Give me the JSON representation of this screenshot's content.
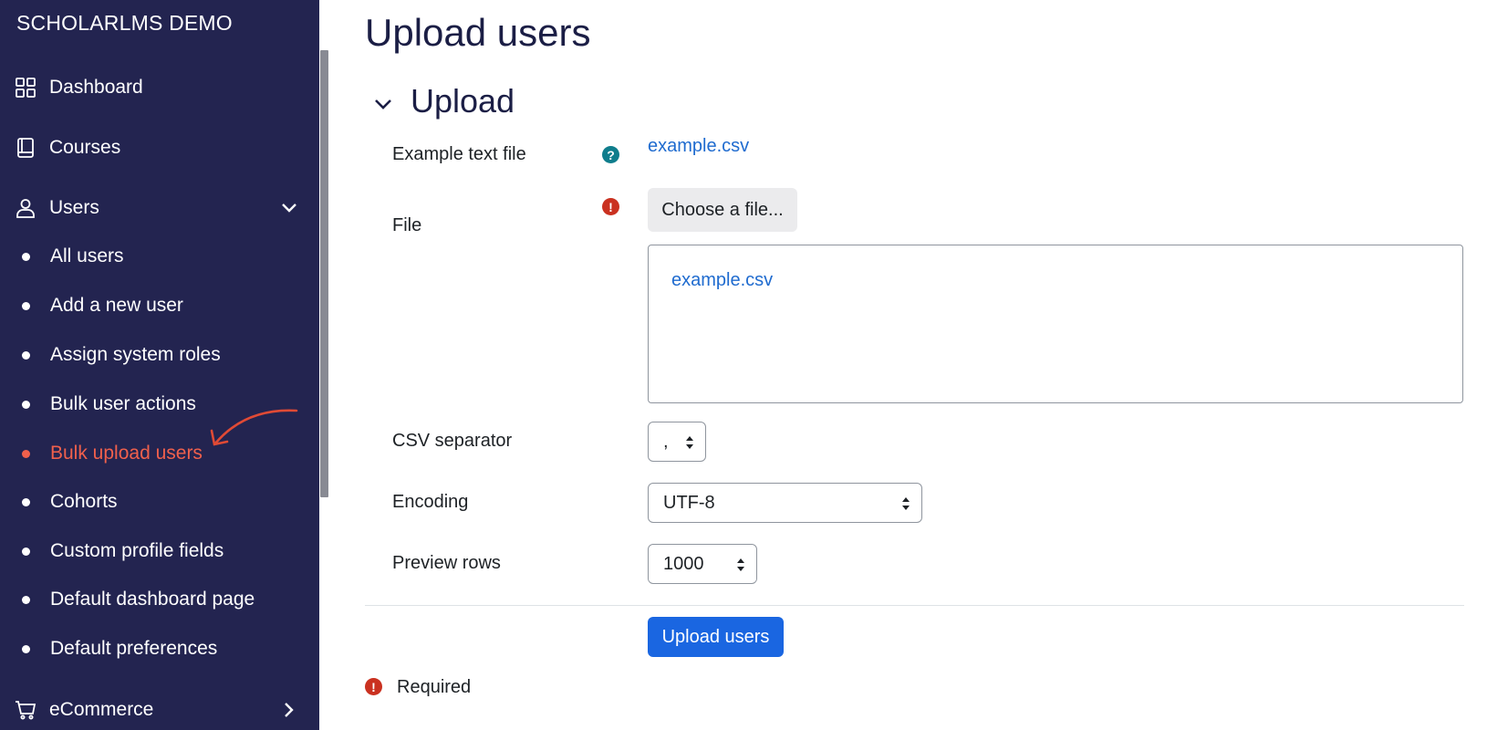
{
  "sidebar": {
    "brand": "SCHOLARLMS DEMO",
    "items": [
      {
        "label": "Dashboard",
        "icon": "grid-icon"
      },
      {
        "label": "Courses",
        "icon": "book-icon"
      },
      {
        "label": "Users",
        "icon": "user-icon",
        "expanded": true
      },
      {
        "label": "eCommerce",
        "icon": "cart-icon"
      }
    ],
    "users_sub": [
      {
        "label": "All users"
      },
      {
        "label": "Add a new user"
      },
      {
        "label": "Assign system roles"
      },
      {
        "label": "Bulk user actions"
      },
      {
        "label": "Bulk upload users",
        "active": true
      },
      {
        "label": "Cohorts"
      },
      {
        "label": "Custom profile fields"
      },
      {
        "label": "Default dashboard page"
      },
      {
        "label": "Default preferences"
      }
    ],
    "active_color": "#f0604c",
    "background": "#232450"
  },
  "main": {
    "title": "Upload users",
    "section": "Upload",
    "example_label": "Example text file",
    "example_link": "example.csv",
    "file_label": "File",
    "choose_button": "Choose a file...",
    "file_item": "example.csv",
    "csv_label": "CSV separator",
    "csv_value": ",",
    "encoding_label": "Encoding",
    "encoding_value": "UTF-8",
    "preview_label": "Preview rows",
    "preview_value": "1000",
    "submit": "Upload users",
    "required_note": "Required"
  }
}
